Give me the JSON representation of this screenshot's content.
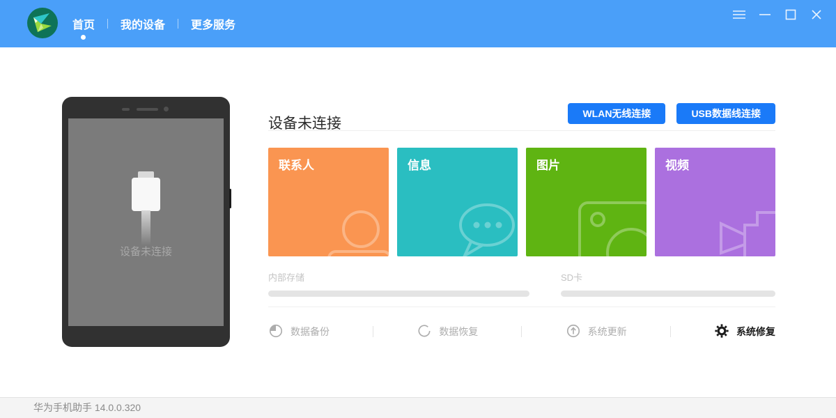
{
  "header": {
    "nav": [
      {
        "label": "首页",
        "active": true
      },
      {
        "label": "我的设备",
        "active": false
      },
      {
        "label": "更多服务",
        "active": false
      }
    ],
    "window_controls": [
      "menu-icon",
      "minimize-icon",
      "maximize-icon",
      "close-icon"
    ],
    "bar_color": "#4A9FF9"
  },
  "device_panel": {
    "status_text": "设备未连接"
  },
  "main": {
    "title": "设备未连接",
    "buttons": [
      {
        "label": "WLAN无线连接",
        "color": "#1A7AF8"
      },
      {
        "label": "USB数据线连接",
        "color": "#1A7AF8"
      }
    ],
    "cards": [
      {
        "label": "联系人",
        "color": "#FA9551",
        "icon": "contacts-icon"
      },
      {
        "label": "信息",
        "color": "#2ABEC1",
        "icon": "messages-icon"
      },
      {
        "label": "图片",
        "color": "#5FB412",
        "icon": "pictures-icon"
      },
      {
        "label": "视频",
        "color": "#AB70DF",
        "icon": "videos-icon"
      }
    ],
    "storage": [
      {
        "label": "内部存储"
      },
      {
        "label": "SD卡"
      }
    ],
    "actions": [
      {
        "label": "数据备份",
        "icon": "backup-icon",
        "enabled": false
      },
      {
        "label": "数据恢复",
        "icon": "restore-icon",
        "enabled": false
      },
      {
        "label": "系统更新",
        "icon": "update-icon",
        "enabled": false
      },
      {
        "label": "系统修复",
        "icon": "repair-icon",
        "enabled": true
      }
    ]
  },
  "footer": {
    "text": "华为手机助手 14.0.0.320"
  }
}
